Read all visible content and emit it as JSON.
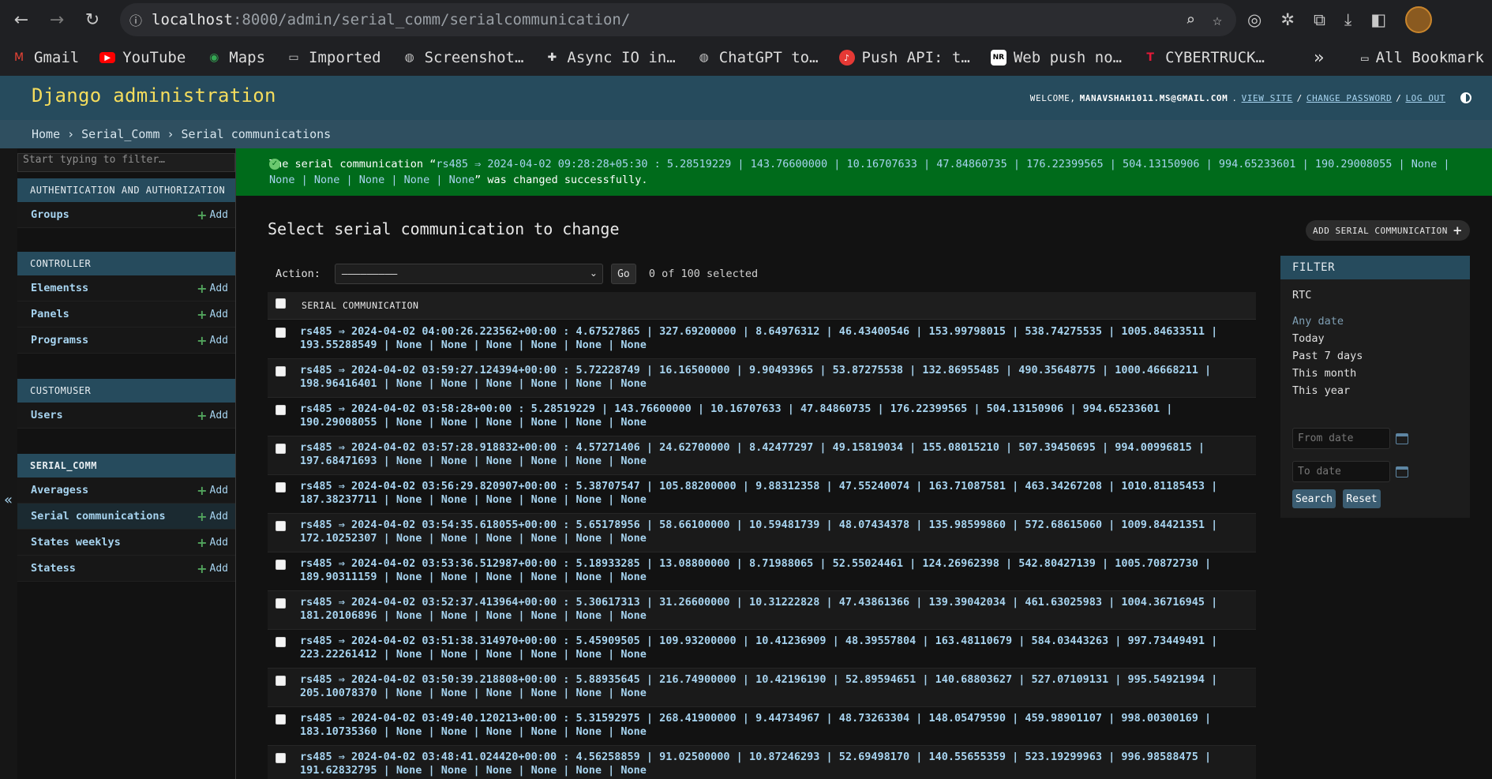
{
  "browser": {
    "url_host": "localhost",
    "url_path": ":8000/admin/serial_comm/serialcommunication/",
    "bookmarks": [
      {
        "label": "Gmail",
        "icon": "gmail-icon",
        "color": "#ea4335"
      },
      {
        "label": "YouTube",
        "icon": "youtube-icon",
        "color": "#ff0000"
      },
      {
        "label": "Maps",
        "icon": "maps-pin-icon",
        "color": "#34a853"
      },
      {
        "label": "Imported",
        "icon": "folder-icon",
        "color": "#c8c8c8"
      },
      {
        "label": "Screenshot…",
        "icon": "globe-icon",
        "color": "#c8c8c8"
      },
      {
        "label": "Async IO in…",
        "icon": "python-icon",
        "color": "#dcdcdc"
      },
      {
        "label": "ChatGPT to…",
        "icon": "globe-icon",
        "color": "#c8c8c8"
      },
      {
        "label": "Push API: t…",
        "icon": "bell-icon",
        "color": "#e53935"
      },
      {
        "label": "Web push no…",
        "icon": "nr-icon",
        "color": "#ffffff"
      },
      {
        "label": "CYBERTRUCK…",
        "icon": "tesla-icon",
        "color": "#e31937"
      }
    ],
    "all_bookmarks": "All Bookmark"
  },
  "header": {
    "branding": "Django administration",
    "welcome": "WELCOME,",
    "user": "MANAVSHAH1011.MS@GMAIL.COM",
    "view_site": "VIEW SITE",
    "change_password": "CHANGE PASSWORD",
    "log_out": "LOG OUT"
  },
  "breadcrumbs": {
    "home": "Home",
    "app": "Serial_Comm",
    "current": "Serial communications"
  },
  "sidebar": {
    "filter_placeholder": "Start typing to filter…",
    "add_label": "Add",
    "apps": [
      {
        "caption": "AUTHENTICATION AND AUTHORIZATION",
        "models": [
          "Groups"
        ]
      },
      {
        "caption": "CONTROLLER",
        "models": [
          "Elementss",
          "Panels",
          "Programss"
        ]
      },
      {
        "caption": "CUSTOMUSER",
        "models": [
          "Users"
        ]
      },
      {
        "caption": "SERIAL_COMM",
        "models": [
          "Averagess",
          "Serial communications",
          "States weeklys",
          "Statess"
        ]
      }
    ]
  },
  "message": {
    "prefix": "The serial communication “",
    "object": "rs485 ⇒ 2024-04-02 09:28:28+05:30 : 5.28519229 | 143.76600000 | 10.16707633 | 47.84860735 | 176.22399565 | 504.13150906 | 994.65233601 | 190.29008055 | None | None | None | None | None | None",
    "suffix": "” was changed successfully."
  },
  "content": {
    "title": "Select serial communication to change",
    "add_button": "ADD SERIAL COMMUNICATION",
    "action_label": "Action:",
    "action_value": "—————————",
    "go_label": "Go",
    "selected_count": "0 of 100 selected",
    "column_header": "SERIAL COMMUNICATION",
    "rows": [
      "rs485 ⇒ 2024-04-02 04:00:26.223562+00:00 : 4.67527865 | 327.69200000 | 8.64976312 | 46.43400546 | 153.99798015 | 538.74275535 | 1005.84633511 | 193.55288549 | None | None | None | None | None | None",
      "rs485 ⇒ 2024-04-02 03:59:27.124394+00:00 : 5.72228749 | 16.16500000 | 9.90493965 | 53.87275538 | 132.86955485 | 490.35648775 | 1000.46668211 | 198.96416401 | None | None | None | None | None | None",
      "rs485 ⇒ 2024-04-02 03:58:28+00:00 : 5.28519229 | 143.76600000 | 10.16707633 | 47.84860735 | 176.22399565 | 504.13150906 | 994.65233601 | 190.29008055 | None | None | None | None | None | None",
      "rs485 ⇒ 2024-04-02 03:57:28.918832+00:00 : 4.57271406 | 24.62700000 | 8.42477297 | 49.15819034 | 155.08015210 | 507.39450695 | 994.00996815 | 197.68471693 | None | None | None | None | None | None",
      "rs485 ⇒ 2024-04-02 03:56:29.820907+00:00 : 5.38707547 | 105.88200000 | 9.88312358 | 47.55240074 | 163.71087581 | 463.34267208 | 1010.81185453 | 187.38237711 | None | None | None | None | None | None",
      "rs485 ⇒ 2024-04-02 03:54:35.618055+00:00 : 5.65178956 | 58.66100000 | 10.59481739 | 48.07434378 | 135.98599860 | 572.68615060 | 1009.84421351 | 172.10252307 | None | None | None | None | None | None",
      "rs485 ⇒ 2024-04-02 03:53:36.512987+00:00 : 5.18933285 | 13.08800000 | 8.71988065 | 52.55024461 | 124.26962398 | 542.80427139 | 1005.70872730 | 189.90311159 | None | None | None | None | None | None",
      "rs485 ⇒ 2024-04-02 03:52:37.413964+00:00 : 5.30617313 | 31.26600000 | 10.31222828 | 47.43861366 | 139.39042034 | 461.63025983 | 1004.36716945 | 181.20106896 | None | None | None | None | None | None",
      "rs485 ⇒ 2024-04-02 03:51:38.314970+00:00 : 5.45909505 | 109.93200000 | 10.41236909 | 48.39557804 | 163.48110679 | 584.03443263 | 997.73449491 | 223.22261412 | None | None | None | None | None | None",
      "rs485 ⇒ 2024-04-02 03:50:39.218808+00:00 : 5.88935645 | 216.74900000 | 10.42196190 | 52.89594651 | 140.68803627 | 527.07109131 | 995.54921994 | 205.10078370 | None | None | None | None | None | None",
      "rs485 ⇒ 2024-04-02 03:49:40.120213+00:00 : 5.31592975 | 268.41900000 | 9.44734967 | 48.73263304 | 148.05479590 | 459.98901107 | 998.00300169 | 183.10735360 | None | None | None | None | None | None",
      "rs485 ⇒ 2024-04-02 03:48:41.024420+00:00 : 4.56258859 | 91.02500000 | 10.87246293 | 52.69498170 | 140.55655359 | 523.19299963 | 996.98588475 | 191.62832795 | None | None | None | None | None | None"
    ]
  },
  "filter": {
    "title": "FILTER",
    "field": "RTC",
    "options": [
      "Any date",
      "Today",
      "Past 7 days",
      "This month",
      "This year"
    ],
    "from_placeholder": "From date",
    "to_placeholder": "To date",
    "search": "Search",
    "reset": "Reset"
  }
}
